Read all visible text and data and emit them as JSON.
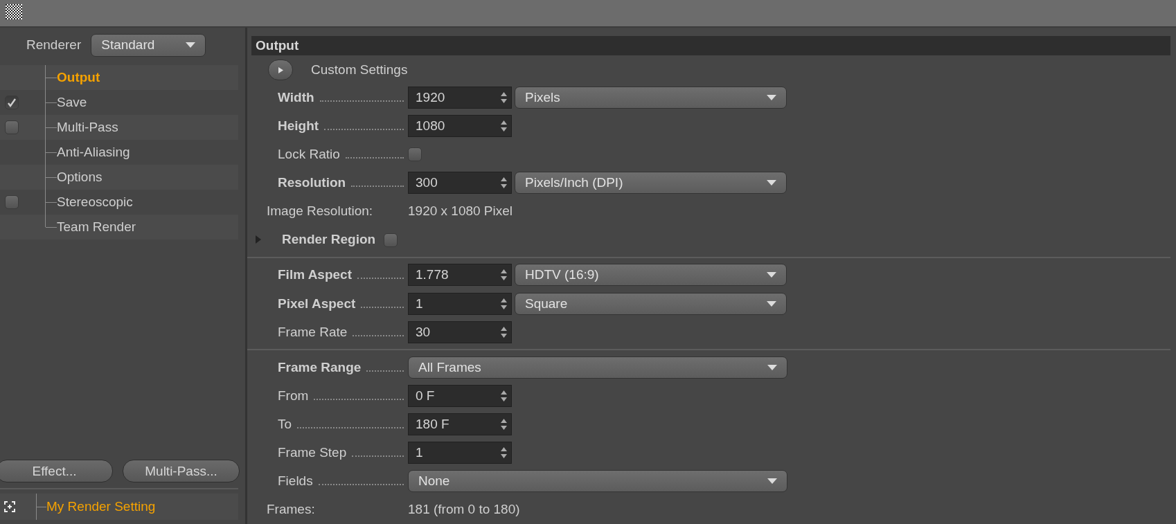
{
  "renderer": {
    "label": "Renderer",
    "value": "Standard"
  },
  "sidebar": {
    "items": [
      {
        "label": "Output",
        "kind": "plain",
        "selected": true
      },
      {
        "label": "Save",
        "kind": "toggle",
        "checked": true,
        "selected": false
      },
      {
        "label": "Multi-Pass",
        "kind": "toggle",
        "checked": false,
        "selected": false
      },
      {
        "label": "Anti-Aliasing",
        "kind": "plain",
        "selected": false
      },
      {
        "label": "Options",
        "kind": "plain",
        "selected": false
      },
      {
        "label": "Stereoscopic",
        "kind": "toggle",
        "checked": false,
        "selected": false
      },
      {
        "label": "Team Render",
        "kind": "plain",
        "selected": false
      }
    ]
  },
  "buttons": [
    "Effect...",
    "Multi-Pass..."
  ],
  "render_settings": [
    {
      "label": "My Render Setting",
      "selected": true
    }
  ],
  "section": {
    "title": "Output",
    "preset": "Custom Settings",
    "fields": [
      {
        "kind": "number",
        "label": "Width",
        "bold": true,
        "value": "1920",
        "unit": "Pixels"
      },
      {
        "kind": "number",
        "label": "Height",
        "bold": true,
        "value": "1080"
      },
      {
        "kind": "checkbox",
        "label": "Lock Ratio",
        "bold": false,
        "checked": false
      },
      {
        "kind": "number",
        "label": "Resolution",
        "bold": true,
        "value": "300",
        "unit": "Pixels/Inch (DPI)"
      },
      {
        "kind": "info",
        "label": "Image Resolution:",
        "value": "1920 x 1080 Pixel"
      },
      {
        "kind": "group",
        "label": "Render Region",
        "bold": true,
        "expanded": false,
        "checked": false
      },
      {
        "kind": "separator"
      },
      {
        "kind": "number",
        "label": "Film Aspect",
        "bold": true,
        "value": "1.778",
        "unit": "HDTV (16:9)"
      },
      {
        "kind": "number",
        "label": "Pixel Aspect",
        "bold": true,
        "value": "1",
        "unit": "Square"
      },
      {
        "kind": "number",
        "label": "Frame Rate",
        "bold": false,
        "value": "30"
      },
      {
        "kind": "separator"
      },
      {
        "kind": "select",
        "label": "Frame Range",
        "bold": true,
        "value": "All Frames"
      },
      {
        "kind": "number",
        "label": "From",
        "bold": false,
        "value": "0 F"
      },
      {
        "kind": "number",
        "label": "To",
        "bold": false,
        "value": "180 F"
      },
      {
        "kind": "number",
        "label": "Frame Step",
        "bold": false,
        "value": "1"
      },
      {
        "kind": "select",
        "label": "Fields",
        "bold": false,
        "value": "None"
      },
      {
        "kind": "info",
        "label": "Frames:",
        "value": "181 (from 0 to 180)"
      }
    ]
  }
}
